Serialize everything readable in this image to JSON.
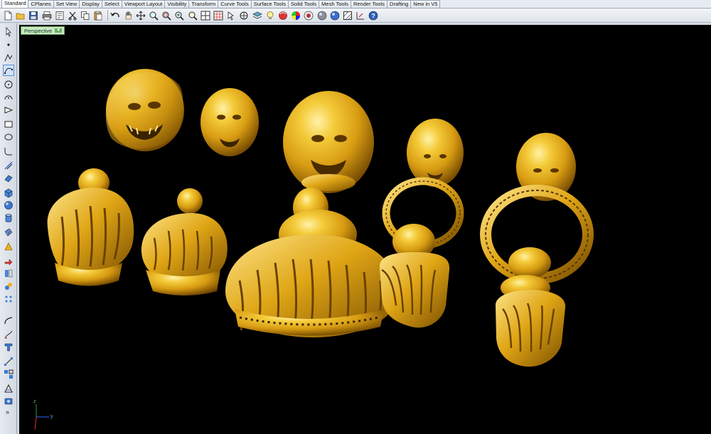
{
  "tabs": [
    "Standard",
    "CPlanes",
    "Set View",
    "Display",
    "Select",
    "Viewport Layout",
    "Visibility",
    "Transform",
    "Curve Tools",
    "Surface Tools",
    "Solid Tools",
    "Mesh Tools",
    "Render Tools",
    "Drafting",
    "New in V5"
  ],
  "active_tab": "Standard",
  "viewport": {
    "name": "Perspective",
    "axis_y": "y",
    "axis_z": "z"
  },
  "left_toolbar": {
    "more_label": "»"
  },
  "colors": {
    "viewport_bg": "#000000",
    "gold": "#e0a616",
    "viewport_tab": "#c7e8c0"
  }
}
